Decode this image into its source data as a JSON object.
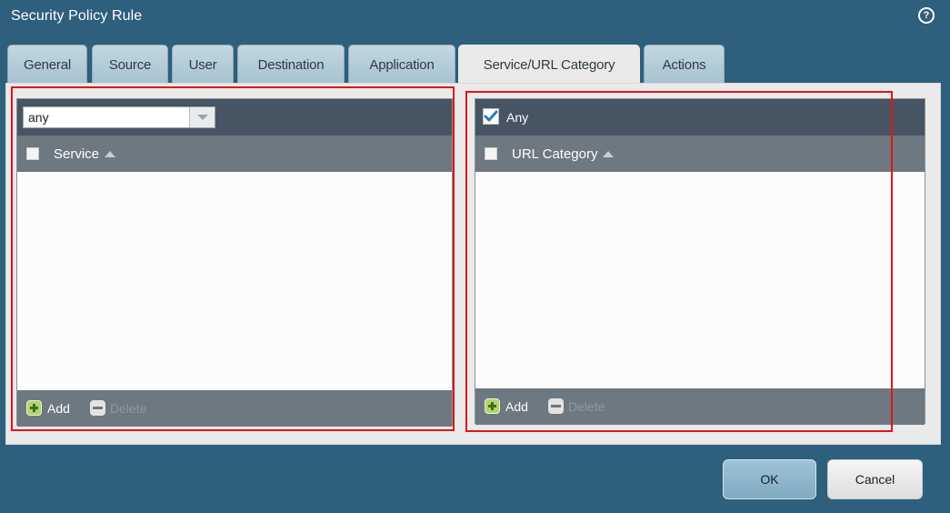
{
  "window": {
    "title": "Security Policy Rule",
    "help_glyph": "?"
  },
  "tabs": [
    {
      "label": "General",
      "active": false
    },
    {
      "label": "Source",
      "active": false
    },
    {
      "label": "User",
      "active": false
    },
    {
      "label": "Destination",
      "active": false
    },
    {
      "label": "Application",
      "active": false
    },
    {
      "label": "Service/URL Category",
      "active": true
    },
    {
      "label": "Actions",
      "active": false
    }
  ],
  "service": {
    "dropdown_value": "any",
    "column_header": "Service",
    "add_label": "Add",
    "delete_label": "Delete"
  },
  "url_category": {
    "any_label": "Any",
    "any_checked": true,
    "column_header": "URL Category",
    "add_label": "Add",
    "delete_label": "Delete"
  },
  "buttons": {
    "ok": "OK",
    "cancel": "Cancel"
  },
  "colors": {
    "background": "#2e5f7c",
    "panel": "#eaeaea",
    "column_header": "#475563",
    "column_subheader": "#6d7880",
    "highlight": "#e3121b",
    "check": "#2c7bbd"
  }
}
